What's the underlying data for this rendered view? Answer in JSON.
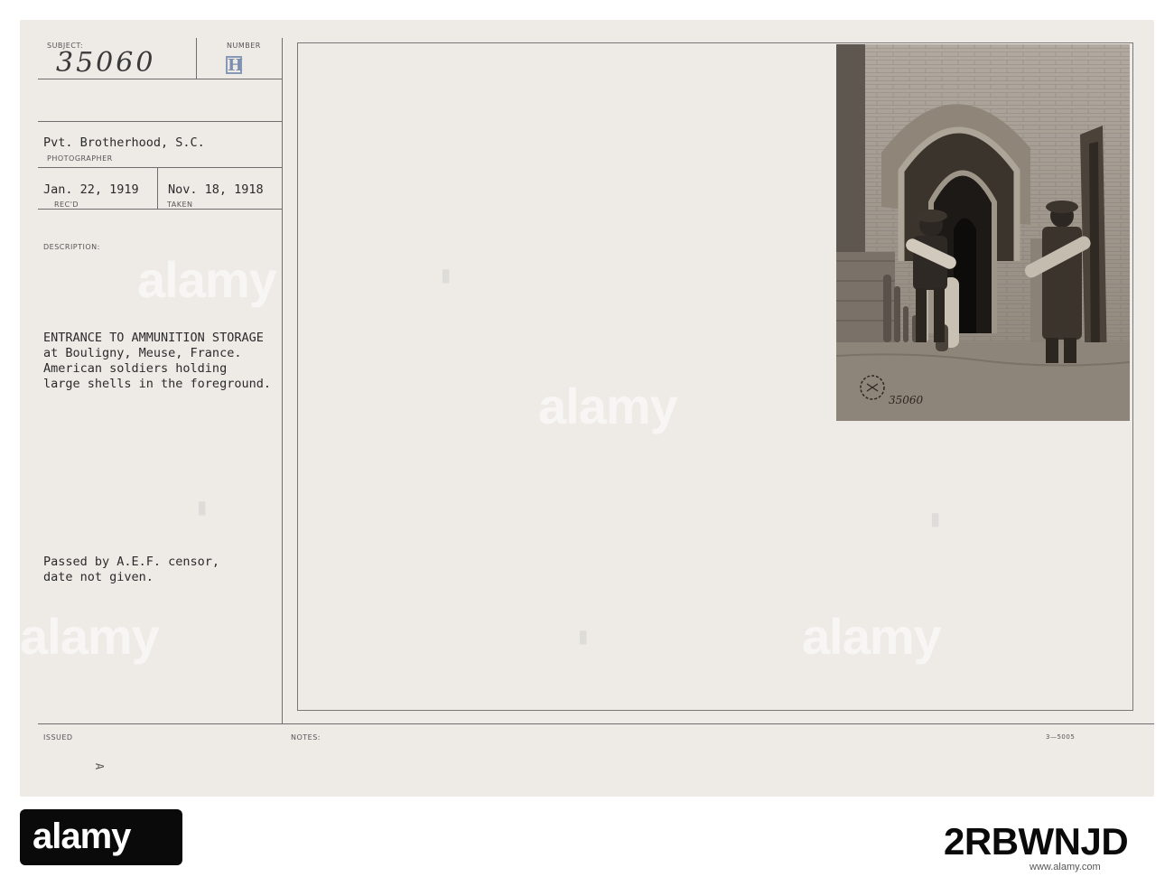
{
  "card": {
    "subject_label": "SUBJECT:",
    "subject_number": "35060",
    "number_label": "NUMBER",
    "number_stamp": "H",
    "photographer": "Pvt. Brotherhood, S.C.",
    "photographer_label": "PHOTOGRAPHER",
    "received_date": "Jan. 22, 1919",
    "received_label": "REC'D",
    "taken_date": "Nov. 18, 1918",
    "taken_label": "TAKEN",
    "description_label": "DESCRIPTION:",
    "description_lines": [
      "ENTRANCE TO AMMUNITION STORAGE",
      "at Bouligny, Meuse, France.",
      "American soldiers holding",
      "large shells in the foreground."
    ],
    "censor_lines": [
      "Passed by A.E.F. censor,",
      "date not given."
    ],
    "issued_label": "ISSUED",
    "issued_mark": "A",
    "notes_label": "NOTES:",
    "form_code": "3—5005",
    "photo_inscription": "35060"
  },
  "watermark": {
    "text": "alamy"
  },
  "footer": {
    "brand": "alamy",
    "image_id": "2RBWNJD",
    "url": "www.alamy.com"
  }
}
